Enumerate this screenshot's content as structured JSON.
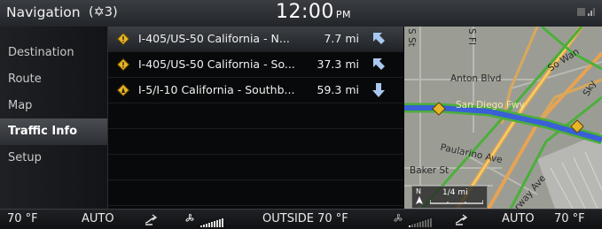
{
  "header": {
    "title": "Navigation",
    "counter": "(✡3)",
    "time": "12:00",
    "ampm": "PM"
  },
  "sidebar": {
    "items": [
      {
        "label": "Destination",
        "active": false
      },
      {
        "label": "Route",
        "active": false
      },
      {
        "label": "Map",
        "active": false
      },
      {
        "label": "Traffic Info",
        "active": true
      },
      {
        "label": "Setup",
        "active": false
      }
    ]
  },
  "traffic": {
    "items": [
      {
        "road": "I-405/US-50 California - N...",
        "distance": "7.7 mi",
        "direction": "northwest-arrow-icon",
        "selected": true
      },
      {
        "road": "I-405/US-50 California - So...",
        "distance": "37.3 mi",
        "direction": "northwest-arrow-icon",
        "selected": false
      },
      {
        "road": "I-5/I-10 California - Southb...",
        "distance": "59.3 mi",
        "direction": "down-arrow-icon",
        "selected": false
      }
    ]
  },
  "map": {
    "labels": {
      "s_st": "S St",
      "s_fl": "S Fl",
      "so_wan": "So Wan",
      "anton_blvd": "Anton Blvd",
      "san_diego_fwy": "San Diego Fwy",
      "paularino_ave": "Paularino Ave",
      "baker_st": "Baker St",
      "way_ave": "rway Ave",
      "sky": "Sky"
    },
    "scale": "1/4 mi",
    "north": "N"
  },
  "climate": {
    "left_temp": "70 °F",
    "left_mode": "AUTO",
    "outside": "OUTSIDE 70 °F",
    "right_mode": "AUTO",
    "right_temp": "70 °F"
  },
  "colors": {
    "route_blue": "#3a5fd6",
    "road_green": "#4caf3a",
    "road_orange": "#e2a14a",
    "warning_yellow": "#e8b526",
    "arrow_blue": "#a9c8f0"
  }
}
